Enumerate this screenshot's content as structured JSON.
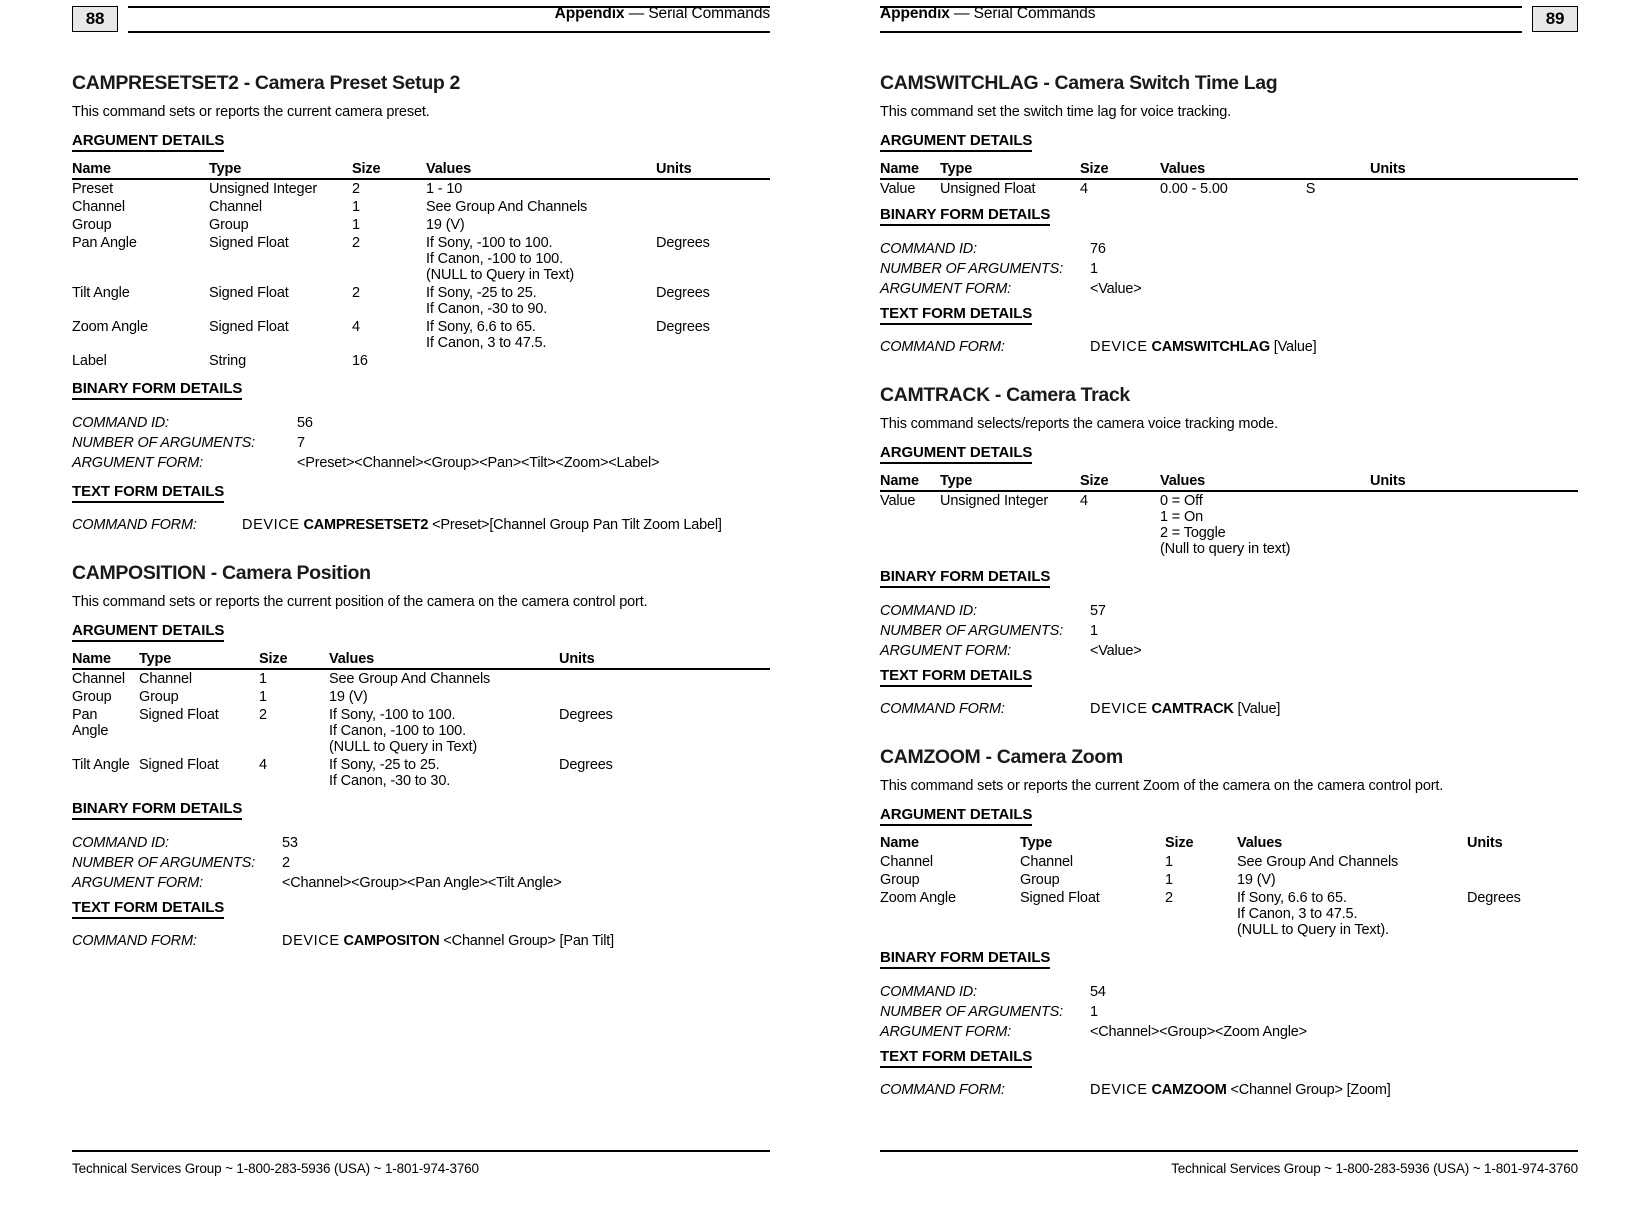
{
  "pages": [
    {
      "folio": "88",
      "running_head": {
        "bold": "Appendix",
        "dash": "—",
        "rest": "Serial Commands"
      },
      "footer": "Technical Services Group ~ 1-800-283-5936 (USA) ~ 1-801-974-3760",
      "sections": [
        {
          "title": "CAMPRESETSET2 - Camera Preset Setup 2",
          "description": "This command sets or reports the current camera preset.",
          "argument_details_label": "ARGUMENT DETAILS",
          "table": {
            "headers": [
              "Name",
              "Type",
              "Size",
              "Values",
              "Units"
            ],
            "rows": [
              {
                "name": "Preset",
                "type": "Unsigned Integer",
                "size": "2",
                "values": [
                  "1 - 10"
                ],
                "units": ""
              },
              {
                "name": "Channel",
                "type": "Channel",
                "size": "1",
                "values": [
                  "See Group And Channels"
                ],
                "units": ""
              },
              {
                "name": "Group",
                "type": "Group",
                "size": "1",
                "values": [
                  "19 (V)"
                ],
                "units": ""
              },
              {
                "name": "Pan Angle",
                "type": "Signed Float",
                "size": "2",
                "values": [
                  "If Sony, -100 to 100.",
                  "If Canon, -100 to 100.",
                  "(NULL to Query in Text)"
                ],
                "units": "Degrees"
              },
              {
                "name": "Tilt Angle",
                "type": "Signed Float",
                "size": "2",
                "values": [
                  "If Sony, -25 to 25.",
                  "If Canon, -30 to 90."
                ],
                "units": "Degrees"
              },
              {
                "name": "Zoom Angle",
                "type": "Signed Float",
                "size": "4",
                "values": [
                  "If Sony, 6.6 to 65.",
                  "If Canon, 3 to 47.5."
                ],
                "units": "Degrees"
              },
              {
                "name": "Label",
                "type": "String",
                "size": "16",
                "values": [
                  ""
                ],
                "units": ""
              }
            ]
          },
          "binary_label": "BINARY FORM DETAILS",
          "binary": {
            "command_id_label": "COMMAND ID:",
            "command_id": "56",
            "num_args_label": "NUMBER OF ARGUMENTS:",
            "num_args": "7",
            "arg_form_label": "ARGUMENT FORM:",
            "arg_form": "<Preset><Channel><Group><Pan><Tilt><Zoom><Label>"
          },
          "text_label": "TEXT FORM DETAILS",
          "text_form": {
            "command_form_label": "COMMAND FORM:",
            "device": "DEVICE",
            "command": "CAMPRESETSET2",
            "args": "<Preset>[Channel Group Pan Tilt Zoom Label]"
          }
        },
        {
          "title": "CAMPOSITION - Camera Position",
          "description": "This command sets or reports the current position of the camera on the camera control port.",
          "argument_details_label": "ARGUMENT DETAILS",
          "table": {
            "headers": [
              "Name",
              "Type",
              "Size",
              "Values",
              "Units"
            ],
            "rows": [
              {
                "name": "Channel",
                "type": "Channel",
                "size": "1",
                "values": [
                  "See Group And Channels"
                ],
                "units": ""
              },
              {
                "name": "Group",
                "type": "Group",
                "size": "1",
                "values": [
                  "19 (V)"
                ],
                "units": ""
              },
              {
                "name": "Pan Angle",
                "type": "Signed Float",
                "size": "2",
                "values": [
                  "If Sony, -100 to 100.",
                  "If Canon, -100 to 100.",
                  "(NULL to Query in Text)"
                ],
                "units": "Degrees"
              },
              {
                "name": "Tilt Angle",
                "type": "Signed Float",
                "size": "4",
                "values": [
                  "If Sony, -25 to 25.",
                  "If Canon, -30 to 30."
                ],
                "units": "Degrees"
              }
            ]
          },
          "binary_label": "BINARY FORM DETAILS",
          "binary": {
            "command_id_label": "COMMAND ID:",
            "command_id": "53",
            "num_args_label": "NUMBER OF ARGUMENTS:",
            "num_args": "2",
            "arg_form_label": "ARGUMENT FORM:",
            "arg_form": "<Channel><Group><Pan Angle><Tilt Angle>"
          },
          "text_label": "TEXT FORM DETAILS",
          "text_form": {
            "command_form_label": "COMMAND FORM:",
            "device": "DEVICE",
            "command": "CAMPOSITON",
            "args": "<Channel Group> [Pan Tilt]"
          }
        }
      ]
    },
    {
      "folio": "89",
      "running_head": {
        "bold": "Appendix",
        "dash": "—",
        "rest": "Serial Commands"
      },
      "footer": "Technical Services Group ~ 1-800-283-5936 (USA) ~ 1-801-974-3760",
      "sections": [
        {
          "title": "CAMSWITCHLAG - Camera Switch Time Lag",
          "description": "This command set the switch time lag for voice tracking.",
          "argument_details_label": "ARGUMENT DETAILS",
          "table": {
            "headers": [
              "Name",
              "Type",
              "Size",
              "Values",
              "Units"
            ],
            "rows": [
              {
                "name": "Value",
                "type": "Unsigned Float",
                "size": "4",
                "values": [
                  "0.00 - 5.00"
                ],
                "units": "S"
              }
            ]
          },
          "binary_label": "BINARY FORM DETAILS",
          "binary": {
            "command_id_label": "COMMAND ID:",
            "command_id": "76",
            "num_args_label": "NUMBER OF ARGUMENTS:",
            "num_args": "1",
            "arg_form_label": "ARGUMENT FORM:",
            "arg_form": "<Value>"
          },
          "text_label": "TEXT FORM DETAILS",
          "text_form": {
            "command_form_label": "COMMAND FORM:",
            "device": "DEVICE",
            "command": "CAMSWITCHLAG",
            "args": "[Value]"
          }
        },
        {
          "title": "CAMTRACK - Camera Track",
          "description": "This command selects/reports the camera voice tracking mode.",
          "argument_details_label": "ARGUMENT DETAILS",
          "table": {
            "headers": [
              "Name",
              "Type",
              "Size",
              "Values",
              "Units"
            ],
            "rows": [
              {
                "name": "Value",
                "type": "Unsigned Integer",
                "size": "4",
                "values": [
                  "0 = Off",
                  "1 = On",
                  "2 = Toggle",
                  "(Null to query in text)"
                ],
                "units": ""
              }
            ]
          },
          "binary_label": "BINARY FORM DETAILS",
          "binary": {
            "command_id_label": "COMMAND ID:",
            "command_id": "57",
            "num_args_label": "NUMBER OF ARGUMENTS:",
            "num_args": "1",
            "arg_form_label": "ARGUMENT FORM:",
            "arg_form": "<Value>"
          },
          "text_label": "TEXT FORM DETAILS",
          "text_form": {
            "command_form_label": "COMMAND FORM:",
            "device": "DEVICE",
            "command": "CAMTRACK",
            "args": "[Value]"
          }
        },
        {
          "title": "CAMZOOM - Camera Zoom",
          "description": "This command sets or reports the current Zoom of the camera on the camera control port.",
          "argument_details_label": "ARGUMENT DETAILS",
          "table": {
            "headers": [
              "Name",
              "Type",
              "Size",
              "Values",
              "Units"
            ],
            "rows": [
              {
                "name": "Channel",
                "type": "Channel",
                "size": "1",
                "values": [
                  "See Group And Channels"
                ],
                "units": ""
              },
              {
                "name": "Group",
                "type": "Group",
                "size": "1",
                "values": [
                  "19 (V)"
                ],
                "units": ""
              },
              {
                "name": "Zoom Angle",
                "type": "Signed Float",
                "size": "2",
                "values": [
                  "If Sony, 6.6 to 65.",
                  "If Canon, 3 to 47.5.",
                  "(NULL to Query in Text)."
                ],
                "units": "Degrees"
              }
            ]
          },
          "binary_label": "BINARY FORM DETAILS",
          "binary": {
            "command_id_label": "COMMAND ID:",
            "command_id": "54",
            "num_args_label": "NUMBER OF ARGUMENTS:",
            "num_args": "1",
            "arg_form_label": "ARGUMENT FORM:",
            "arg_form": "<Channel><Group><Zoom Angle>"
          },
          "text_label": "TEXT FORM DETAILS",
          "text_form": {
            "command_form_label": "COMMAND FORM:",
            "device": "DEVICE",
            "command": "CAMZOOM",
            "args": "<Channel Group> [Zoom]"
          }
        }
      ]
    }
  ]
}
